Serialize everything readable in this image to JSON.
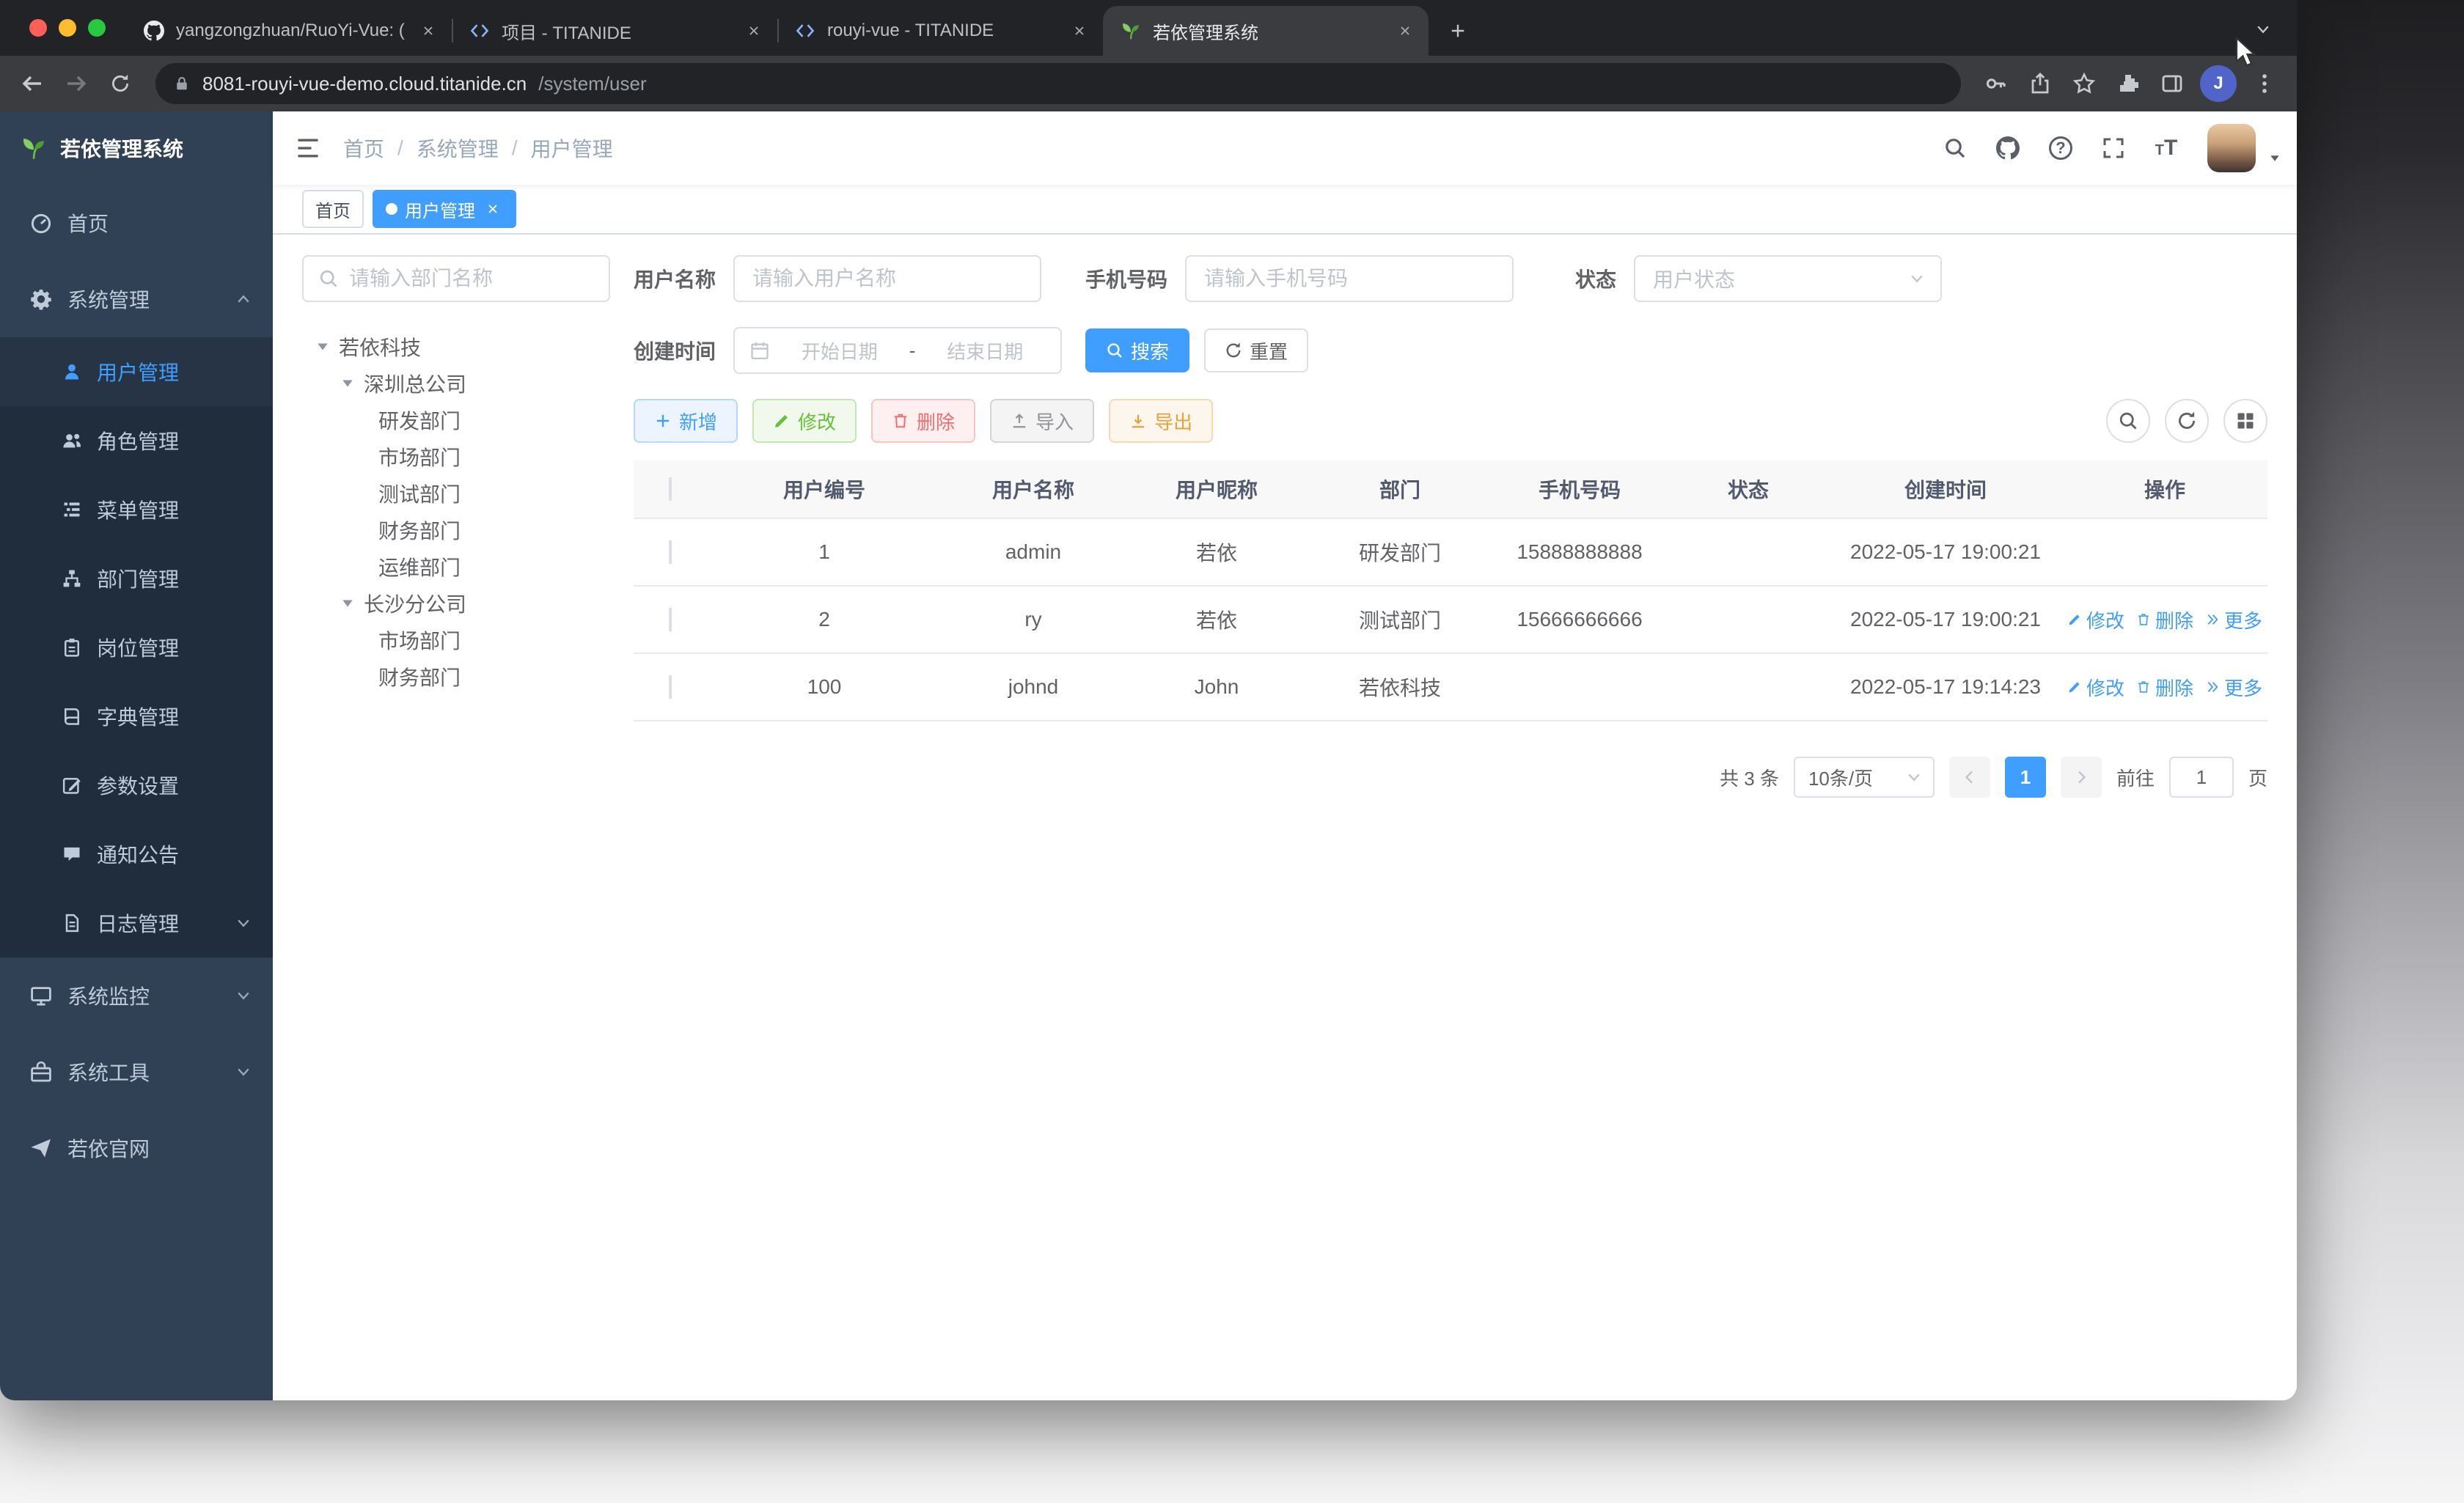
{
  "colors": {
    "primary": "#409EFF",
    "success": "#67C23A",
    "warning": "#E6A23C",
    "danger": "#F56C6C",
    "info": "#909399",
    "sidebar_bg": "#304156",
    "submenu_bg": "#1f2d3d"
  },
  "browser": {
    "tabs": [
      {
        "title": "yangzongzhuan/RuoYi-Vue: (R",
        "icon": "github"
      },
      {
        "title": "项目 - TITANIDE",
        "icon": "code"
      },
      {
        "title": "rouyi-vue - TITANIDE",
        "icon": "code"
      },
      {
        "title": "若依管理系统",
        "icon": "ruoyi-leaf"
      }
    ],
    "url": {
      "host": "8081-rouyi-vue-demo.cloud.titanide.cn",
      "path": "/system/user"
    },
    "profile_initial": "J"
  },
  "sidebar": {
    "logo_title": "若依管理系统",
    "home": "首页",
    "system": "系统管理",
    "system_children": [
      "用户管理",
      "角色管理",
      "菜单管理",
      "部门管理",
      "岗位管理",
      "字典管理",
      "参数设置",
      "通知公告",
      "日志管理"
    ],
    "monitor": "系统监控",
    "tools": "系统工具",
    "site": "若依官网"
  },
  "navbar": {
    "breadcrumb": [
      "首页",
      "系统管理",
      "用户管理"
    ],
    "breadcrumb_separator": "/"
  },
  "tags": {
    "home": "首页",
    "current": "用户管理"
  },
  "dept_panel": {
    "search_placeholder": "请输入部门名称",
    "tree": [
      "若依科技",
      "深圳总公司",
      "研发部门",
      "市场部门",
      "测试部门",
      "财务部门",
      "运维部门",
      "长沙分公司",
      "市场部门",
      "财务部门"
    ]
  },
  "filter": {
    "username_label": "用户名称",
    "username_placeholder": "请输入用户名称",
    "phone_label": "手机号码",
    "phone_placeholder": "请输入手机号码",
    "status_label": "状态",
    "status_placeholder": "用户状态",
    "date_label": "创建时间",
    "date_start_placeholder": "开始日期",
    "date_separator": "-",
    "date_end_placeholder": "结束日期",
    "search_button": "搜索",
    "reset_button": "重置"
  },
  "toolbar": {
    "add": "新增",
    "edit": "修改",
    "delete": "删除",
    "import": "导入",
    "export": "导出"
  },
  "table": {
    "headers": [
      "用户编号",
      "用户名称",
      "用户昵称",
      "部门",
      "手机号码",
      "状态",
      "创建时间",
      "操作"
    ],
    "rows": [
      {
        "id": "1",
        "name": "admin",
        "nick": "若依",
        "dept": "研发部门",
        "phone": "15888888888",
        "status": "on",
        "created": "2022-05-17 19:00:21"
      },
      {
        "id": "2",
        "name": "ry",
        "nick": "若依",
        "dept": "测试部门",
        "phone": "15666666666",
        "status": "on",
        "created": "2022-05-17 19:00:21"
      },
      {
        "id": "100",
        "name": "johnd",
        "nick": "John",
        "dept": "若依科技",
        "phone": "",
        "status": "on",
        "created": "2022-05-17 19:14:23"
      }
    ],
    "actions": {
      "edit": "修改",
      "delete": "删除",
      "more": "更多"
    }
  },
  "pagination": {
    "total": "共 3 条",
    "page_size": "10条/页",
    "page": "1",
    "goto_label": "前往",
    "goto_value": "1",
    "goto_unit": "页"
  }
}
